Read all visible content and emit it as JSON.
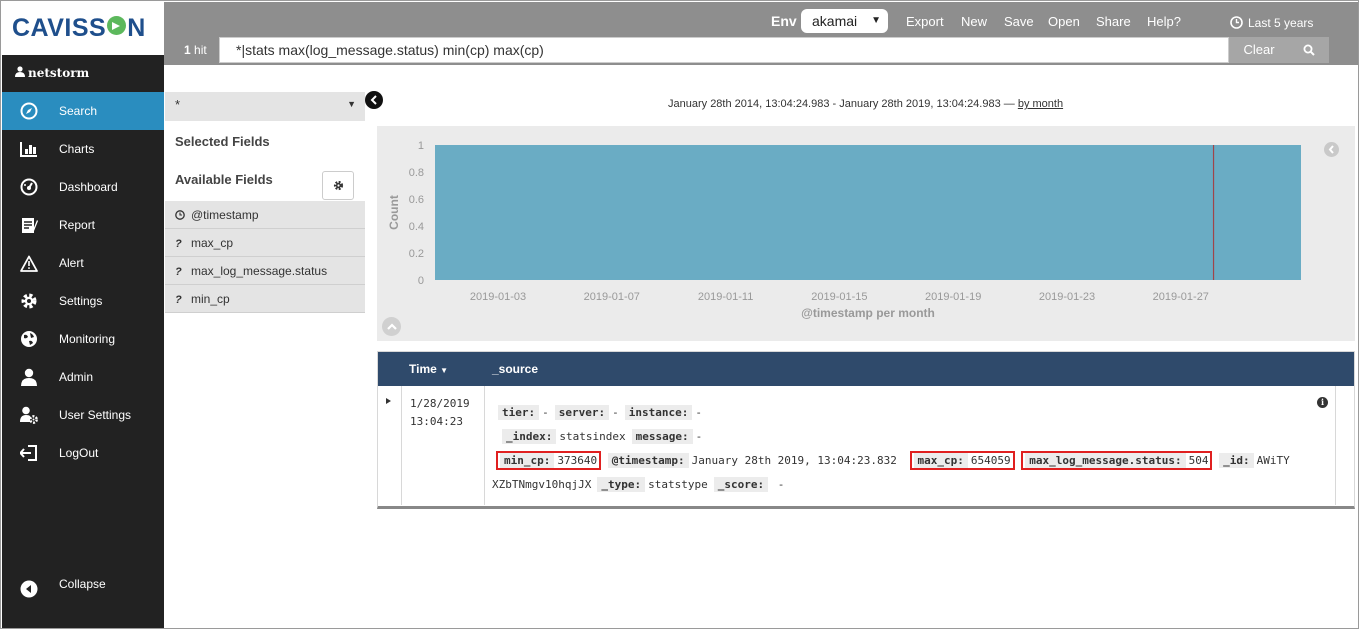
{
  "brand": {
    "name_pre": "CAVISS",
    "name_post": "N",
    "accent": "#5cb85c",
    "color": "#1f4f8c"
  },
  "user": {
    "name": "netstorm",
    "icon": "user-icon"
  },
  "sidebar": {
    "items": [
      {
        "label": "Search",
        "icon": "compass-icon",
        "active": true
      },
      {
        "label": "Charts",
        "icon": "bar-chart-icon",
        "active": false
      },
      {
        "label": "Dashboard",
        "icon": "dashboard-icon",
        "active": false
      },
      {
        "label": "Report",
        "icon": "report-icon",
        "active": false
      },
      {
        "label": "Alert",
        "icon": "warning-icon",
        "active": false
      },
      {
        "label": "Settings",
        "icon": "gear-icon",
        "active": false
      },
      {
        "label": "Monitoring",
        "icon": "globe-icon",
        "active": false
      },
      {
        "label": "Admin",
        "icon": "admin-icon",
        "active": false
      },
      {
        "label": "User Settings",
        "icon": "user-settings-icon",
        "active": false
      },
      {
        "label": "LogOut",
        "icon": "logout-icon",
        "active": false
      }
    ],
    "collapse_label": "Collapse",
    "active_color": "#2a8dbf"
  },
  "topbar": {
    "env_label": "Env",
    "env_value": "akamai",
    "links": [
      "Export",
      "New",
      "Save",
      "Open",
      "Share",
      "Help?"
    ],
    "time_range": "Last 5 years",
    "hits_count": "1",
    "hits_label": "hit",
    "query": "*|stats max(log_message.status) min(cp) max(cp)",
    "clear_label": "Clear"
  },
  "fields_panel": {
    "index_pattern": "*",
    "selected_title": "Selected Fields",
    "available_title": "Available Fields",
    "fields": [
      {
        "type": "clock",
        "name": "@timestamp"
      },
      {
        "type": "?",
        "name": "max_cp"
      },
      {
        "type": "?",
        "name": "max_log_message.status"
      },
      {
        "type": "?",
        "name": "min_cp"
      }
    ]
  },
  "date_range": {
    "text": "January 28th 2014, 13:04:24.983 - January 28th 2019, 13:04:24.983 — ",
    "interval": "by month"
  },
  "chart_data": {
    "type": "bar",
    "x_ticks": [
      "2019-01-03",
      "2019-01-07",
      "2019-01-11",
      "2019-01-15",
      "2019-01-19",
      "2019-01-23",
      "2019-01-27"
    ],
    "y_ticks": [
      "0",
      "0.2",
      "0.4",
      "0.6",
      "0.8",
      "1"
    ],
    "ylim": [
      0,
      1
    ],
    "values": [
      1
    ],
    "xlabel": "@timestamp per month",
    "ylabel": "Count",
    "bar_color": "#6aacc4",
    "marker_color": "#a0444a",
    "grid": false
  },
  "table": {
    "columns": {
      "time": "Time",
      "source": "_source"
    },
    "row": {
      "date": "1/28/2019",
      "time": "13:04:23",
      "tier_key": "tier:",
      "tier_val": "-",
      "server_key": "server:",
      "server_val": "-",
      "instance_key": "instance:",
      "instance_val": "-",
      "index_key": "_index:",
      "index_val": "statsindex",
      "message_key": "message:",
      "message_val": "-",
      "min_cp_key": "min_cp:",
      "min_cp_val": "373640",
      "timestamp_key": "@timestamp:",
      "timestamp_val": "January 28th 2019, 13:04:23.832",
      "max_cp_key": "max_cp:",
      "max_cp_val": "654059",
      "status_key": "max_log_message.status:",
      "status_val": "504",
      "id_key": "_id:",
      "id_val_1": "AWiTY",
      "id_val_2": "XZbTNmgv10hqjJX",
      "type_key": "_type:",
      "type_val": "statstype",
      "score_key": "_score:",
      "score_val": "-"
    }
  }
}
